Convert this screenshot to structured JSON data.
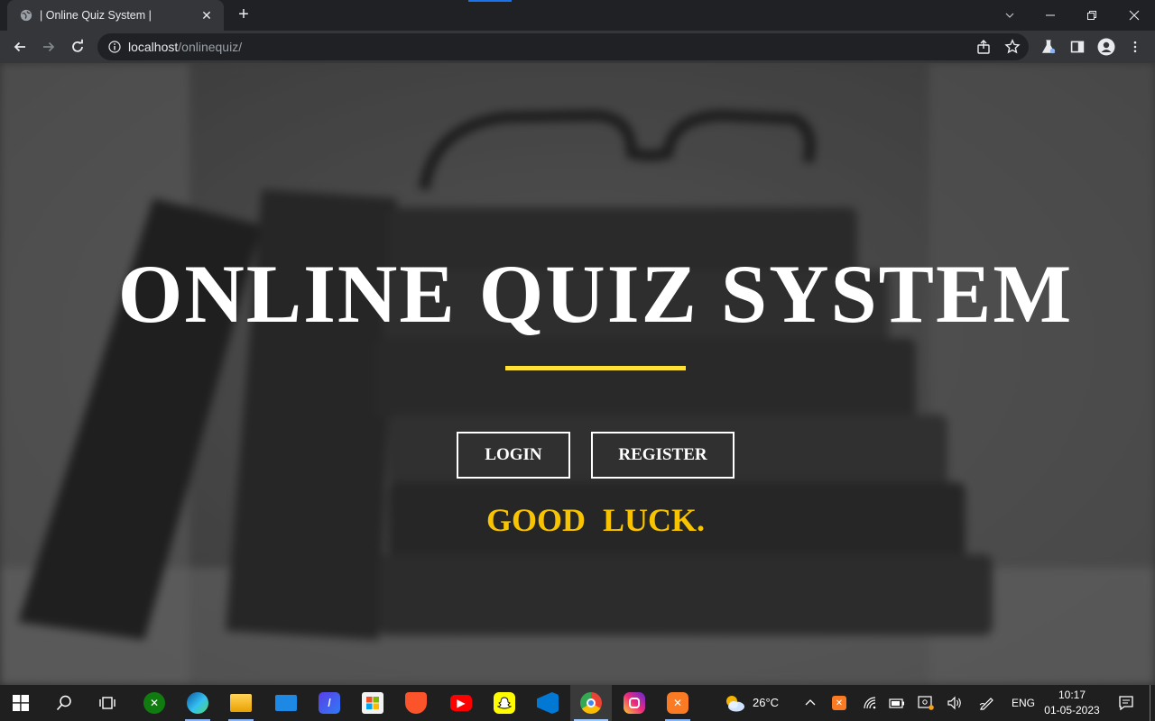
{
  "browser": {
    "tab_title": "| Online Quiz System |",
    "new_tab_glyph": "+",
    "url_host": "localhost",
    "url_path": "/onlinequiz/"
  },
  "page": {
    "title": "ONLINE QUIZ SYSTEM",
    "login_label": "LOGIN",
    "register_label": "REGISTER",
    "tagline": "GOOD  LUCK.",
    "accent_color": "#ffe135",
    "tagline_color": "#f8c300"
  },
  "taskbar": {
    "apps": [
      "start",
      "search",
      "task-view",
      "xbox",
      "edge",
      "file-explorer",
      "mail",
      "code-editor",
      "microsoft-store",
      "brave",
      "youtube",
      "snapchat",
      "vscode",
      "chrome-dev",
      "instagram",
      "xampp"
    ],
    "weather": "26°C",
    "language": "ENG",
    "time": "10:17",
    "date": "01-05-2023"
  }
}
